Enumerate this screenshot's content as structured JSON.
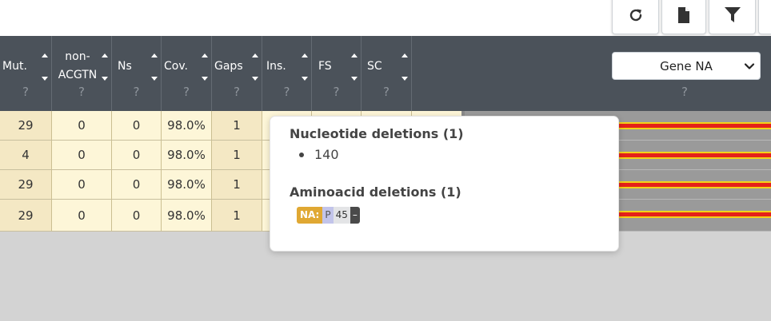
{
  "toolbar": {
    "buttons": [
      {
        "name": "refresh-button",
        "icon": "refresh-icon"
      },
      {
        "name": "export-file-button",
        "icon": "file-icon"
      },
      {
        "name": "filter-button",
        "icon": "filter-icon"
      }
    ]
  },
  "table": {
    "columns": [
      {
        "key": "mut",
        "label": "Mut.",
        "help": "?"
      },
      {
        "key": "non_acgtn",
        "label_line1": "non-",
        "label_line2": "ACGTN",
        "help": "?"
      },
      {
        "key": "ns",
        "label": "Ns",
        "help": "?"
      },
      {
        "key": "cov",
        "label": "Cov.",
        "help": "?"
      },
      {
        "key": "gaps",
        "label": "Gaps",
        "help": "?"
      },
      {
        "key": "ins",
        "label": "Ins.",
        "help": "?"
      },
      {
        "key": "fs",
        "label": "FS",
        "help": "?"
      },
      {
        "key": "sc",
        "label": "SC",
        "help": "?"
      }
    ],
    "rows": [
      [
        "29",
        "0",
        "0",
        "98.0%",
        "1"
      ],
      [
        "4",
        "0",
        "0",
        "98.0%",
        "1"
      ],
      [
        "29",
        "0",
        "0",
        "98.0%",
        "1"
      ],
      [
        "29",
        "0",
        "0",
        "98.0%",
        "1"
      ]
    ]
  },
  "gene_select": {
    "selected": "Gene NA",
    "help": "?"
  },
  "popover": {
    "nuc_title": "Nucleotide deletions (1)",
    "nuc_items": [
      "140"
    ],
    "aa_title": "Aminoacid deletions (1)",
    "aa_badge": {
      "gene": "NA:",
      "ref": "P",
      "pos": "45",
      "alt": "–"
    }
  },
  "colors": {
    "header_bg": "#4b525a",
    "row_dark": "#f4e8c4",
    "row_light": "#fdf6d8",
    "deletion_bar": "#e52119",
    "deletion_border": "#f2d21a",
    "gene_badge": "#e0a833"
  }
}
